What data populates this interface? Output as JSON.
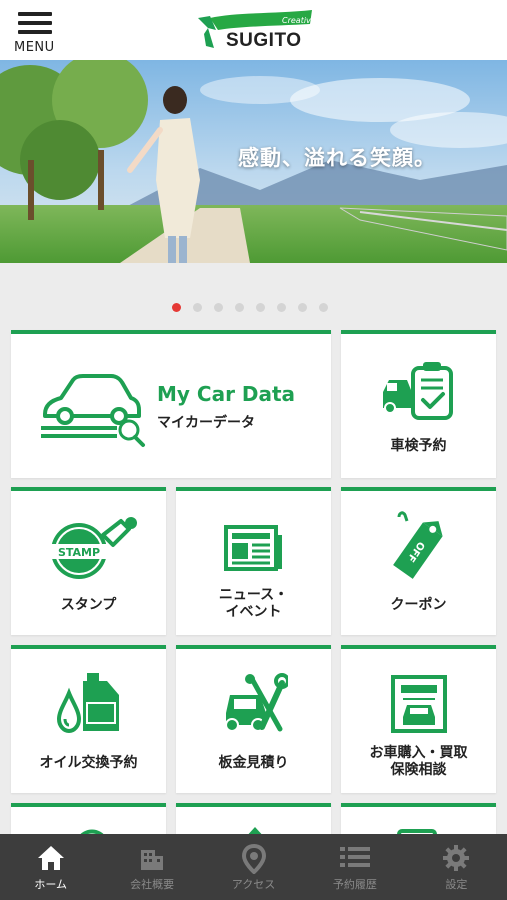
{
  "header": {
    "menu_label": "MENU",
    "logo_text": "SUGITO",
    "logo_tagline": "Creative"
  },
  "hero": {
    "caption": "感動、溢れる笑顔。",
    "slide_count": 8,
    "active_slide": 1
  },
  "tiles": {
    "my_car": {
      "title": "My Car Data",
      "subtitle": "マイカーデータ"
    },
    "inspection": {
      "label": "車検予約"
    },
    "stamp": {
      "label": "スタンプ",
      "icon_text": "STAMP"
    },
    "news": {
      "line1": "ニュース・",
      "line2": "イベント"
    },
    "coupon": {
      "label": "クーポン",
      "icon_text": "OFF"
    },
    "oil": {
      "label": "オイル交換予約"
    },
    "bodywork": {
      "label": "板金見積り"
    },
    "purchase": {
      "line1": "お車購入・買取",
      "line2": "保険相談"
    }
  },
  "nav": {
    "items": [
      {
        "label": "ホーム",
        "icon": "home-icon",
        "active": true
      },
      {
        "label": "会社概要",
        "icon": "building-icon",
        "active": false
      },
      {
        "label": "アクセス",
        "icon": "map-pin-icon",
        "active": false
      },
      {
        "label": "予約履歴",
        "icon": "list-icon",
        "active": false
      },
      {
        "label": "設定",
        "icon": "gear-icon",
        "active": false
      }
    ]
  },
  "colors": {
    "accent": "#1ea052",
    "active_dot": "#e53935",
    "nav_bg": "#3d3d3d"
  }
}
